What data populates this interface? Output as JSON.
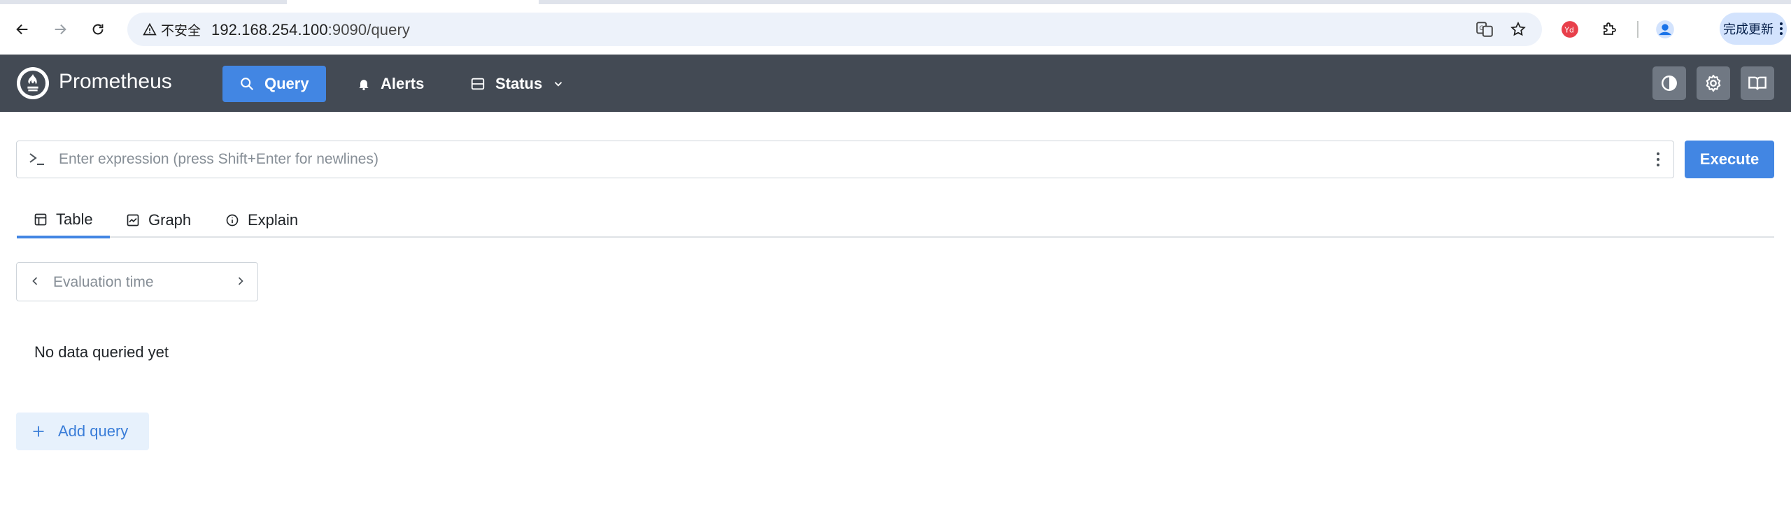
{
  "browser": {
    "security_label": "不安全",
    "url_host": "192.168.254.100",
    "url_path": ":9090/query",
    "update_label": "完成更新"
  },
  "navbar": {
    "brand": "Prometheus",
    "items": [
      {
        "label": "Query",
        "icon": "search-icon",
        "active": true
      },
      {
        "label": "Alerts",
        "icon": "bell-icon",
        "active": false
      },
      {
        "label": "Status",
        "icon": "server-icon",
        "active": false
      }
    ]
  },
  "expression": {
    "placeholder": "Enter expression (press Shift+Enter for newlines)",
    "execute_label": "Execute"
  },
  "tabs": [
    {
      "label": "Table",
      "icon": "table-icon",
      "active": true
    },
    {
      "label": "Graph",
      "icon": "graph-icon",
      "active": false
    },
    {
      "label": "Explain",
      "icon": "info-icon",
      "active": false
    }
  ],
  "evaluation": {
    "placeholder": "Evaluation time"
  },
  "results": {
    "empty_text": "No data queried yet"
  },
  "add_query_label": "Add query",
  "colors": {
    "navbar": "#434a54",
    "accent": "#4286e3"
  }
}
